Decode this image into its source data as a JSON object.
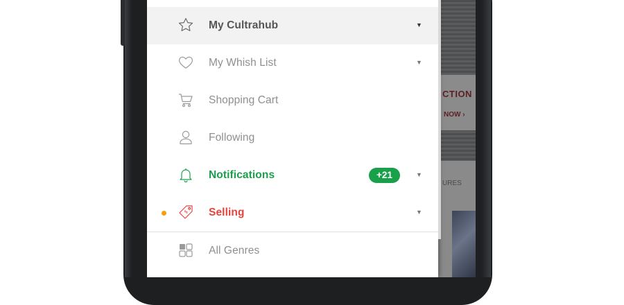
{
  "drawer": {
    "items": [
      {
        "label": "My Cultrahub",
        "icon": "star-icon",
        "state": "active",
        "chevron": "▼"
      },
      {
        "label": "My Whish List",
        "icon": "heart-icon",
        "state": "normal",
        "chevron": "▼"
      },
      {
        "label": "Shopping Cart",
        "icon": "cart-icon",
        "state": "normal",
        "chevron": ""
      },
      {
        "label": "Following",
        "icon": "person-icon",
        "state": "normal",
        "chevron": ""
      },
      {
        "label": "Notifications",
        "icon": "bell-icon",
        "state": "highlight-green",
        "badge": "+21",
        "chevron": "▼"
      },
      {
        "label": "Selling",
        "icon": "price-tag-icon",
        "state": "highlight-red",
        "indicator_dot": "orange",
        "chevron": "▼"
      },
      {
        "label": "All Genres",
        "icon": "grid-icon",
        "state": "normal",
        "chevron": ""
      }
    ]
  },
  "background_app": {
    "promo_title": "CTION",
    "promo_cta": "NOW ›",
    "section_label": "URES"
  },
  "colors": {
    "green": "#1aa04a",
    "red": "#e8423d",
    "orange_dot": "#f5a10b",
    "active_bg": "#f2f2f2",
    "muted_text": "#8f8f8f"
  }
}
